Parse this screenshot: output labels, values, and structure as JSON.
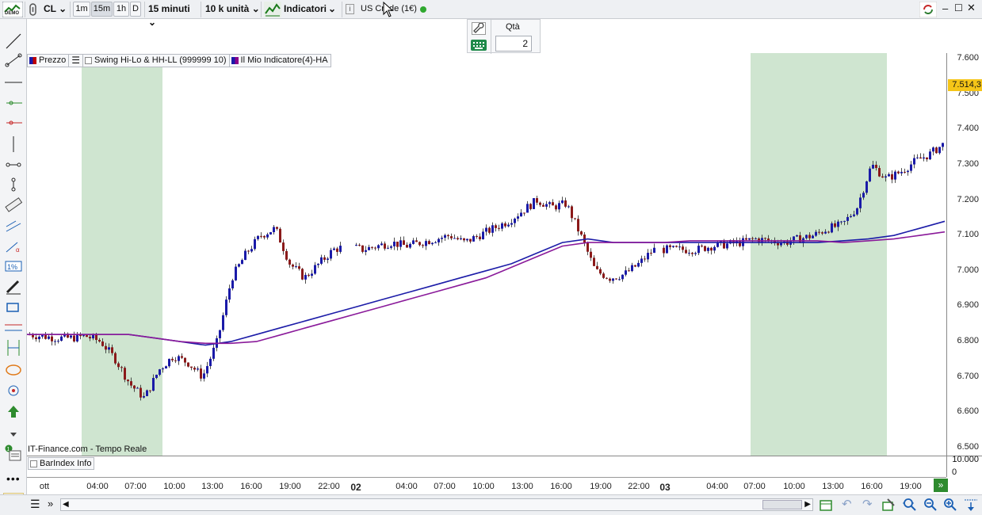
{
  "toolbar": {
    "symbol": "CL",
    "timeframes": [
      "1m",
      "15m",
      "1h",
      "D"
    ],
    "active_timeframe": "15m",
    "interval": "15 minuti",
    "units": "10 k unità",
    "indicators_label": "Indicatori",
    "instrument_label": "US Crude (1€)",
    "demo_badge": "DEMO"
  },
  "order_panel": {
    "qty_label": "Qtà",
    "qty_value": "2"
  },
  "legend": [
    {
      "label": "Prezzo",
      "color": "#1a1aa8",
      "color2": "#c00000"
    },
    {
      "label": "Swing Hi-Lo & HH-LL (999999 10)"
    },
    {
      "label": "Il Mio Indicatore(4)-HA",
      "color": "#1a1aa8",
      "color2": "#8a008a"
    }
  ],
  "price_axis": {
    "ticks": [
      "7.600",
      "7.500",
      "7.400",
      "7.300",
      "7.200",
      "7.100",
      "7.000",
      "6.900",
      "6.800",
      "6.700",
      "6.600",
      "6.500"
    ],
    "current_price": "7.514,3"
  },
  "source_label": "IT-Finance.com - Tempo Reale",
  "sub_panel": {
    "label": "BarIndex Info",
    "ticks": [
      "10.000",
      "0"
    ]
  },
  "time_axis": {
    "labels": [
      {
        "text": "ott",
        "day": false
      },
      {
        "text": "04:00",
        "day": false
      },
      {
        "text": "07:00",
        "day": false
      },
      {
        "text": "10:00",
        "day": false
      },
      {
        "text": "13:00",
        "day": false
      },
      {
        "text": "16:00",
        "day": false
      },
      {
        "text": "19:00",
        "day": false
      },
      {
        "text": "22:00",
        "day": false
      },
      {
        "text": "02",
        "day": true
      },
      {
        "text": "04:00",
        "day": false
      },
      {
        "text": "07:00",
        "day": false
      },
      {
        "text": "10:00",
        "day": false
      },
      {
        "text": "13:00",
        "day": false
      },
      {
        "text": "16:00",
        "day": false
      },
      {
        "text": "19:00",
        "day": false
      },
      {
        "text": "22:00",
        "day": false
      },
      {
        "text": "03",
        "day": true
      },
      {
        "text": "04:00",
        "day": false
      },
      {
        "text": "07:00",
        "day": false
      },
      {
        "text": "10:00",
        "day": false
      },
      {
        "text": "13:00",
        "day": false
      },
      {
        "text": "16:00",
        "day": false
      },
      {
        "text": "19:00",
        "day": false
      }
    ]
  },
  "colors": {
    "up": "#1a1aa8",
    "down": "#8b1a1a",
    "session_shade": "#cfe5d0",
    "ma_blue": "#1c1ca8",
    "ma_purple": "#8a1a9a",
    "price_tag": "#f5c518"
  },
  "chart_data": {
    "type": "line",
    "ylim": [
      6.5,
      7.6
    ],
    "price_series": [
      6.82,
      6.815,
      6.81,
      6.81,
      6.815,
      6.8,
      6.75,
      6.68,
      6.64,
      6.72,
      6.76,
      6.74,
      6.7,
      6.8,
      6.98,
      7.05,
      7.1,
      7.12,
      7.02,
      6.98,
      7.02,
      7.06,
      7.07,
      7.06,
      7.07,
      7.08,
      7.07,
      7.08,
      7.09,
      7.1,
      7.08,
      7.1,
      7.12,
      7.14,
      7.17,
      7.2,
      7.18,
      7.19,
      7.1,
      7.0,
      6.98,
      6.99,
      7.02,
      7.06,
      7.06,
      7.06,
      7.06,
      7.07,
      7.075,
      7.08,
      7.09,
      7.085,
      7.08,
      7.09,
      7.1,
      7.12,
      7.13,
      7.18,
      7.3,
      7.26,
      7.28,
      7.31,
      7.33,
      7.36
    ],
    "series": [
      {
        "name": "Il Mio Indicatore(4)-HA",
        "values": [
          6.82,
          6.82,
          6.82,
          6.82,
          6.82,
          6.81,
          6.8,
          6.79,
          6.8,
          6.82,
          6.84,
          6.86,
          6.88,
          6.9,
          6.92,
          6.94,
          6.96,
          6.98,
          7.0,
          7.02,
          7.05,
          7.08,
          7.09,
          7.08,
          7.08,
          7.08,
          7.08,
          7.08,
          7.08,
          7.08,
          7.08,
          7.08,
          7.085,
          7.09,
          7.1,
          7.12,
          7.14
        ]
      },
      {
        "name": "Il Mio Indicatore(4)-HA",
        "values": [
          6.82,
          6.82,
          6.82,
          6.82,
          6.82,
          6.81,
          6.8,
          6.795,
          6.795,
          6.8,
          6.82,
          6.84,
          6.86,
          6.88,
          6.9,
          6.92,
          6.94,
          6.96,
          6.98,
          7.01,
          7.04,
          7.07,
          7.08,
          7.08,
          7.08,
          7.08,
          7.085,
          7.085,
          7.085,
          7.085,
          7.085,
          7.085,
          7.08,
          7.085,
          7.09,
          7.1,
          7.11
        ]
      }
    ]
  }
}
